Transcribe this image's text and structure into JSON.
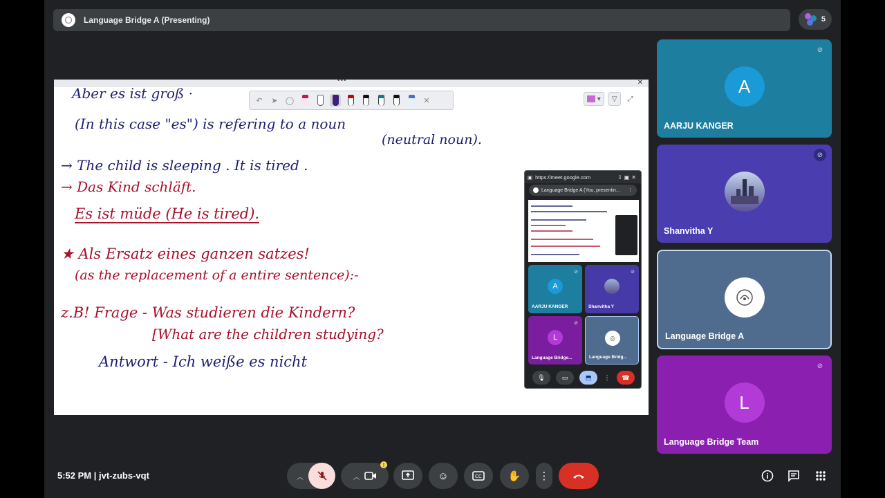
{
  "meeting": {
    "title": "Language Bridge A (Presenting)",
    "participant_count": "5",
    "time_code": "5:52 PM  |  jvt-zubs-vqt"
  },
  "slide": {
    "lines": [
      {
        "text": "Aber es ist groß ·"
      },
      {
        "text": "(In this case \"es\")  is  refering  to a noun"
      },
      {
        "text": "(neutral noun)."
      },
      {
        "text": "→ The child is sleeping . It is tired ."
      },
      {
        "text": "→ Das Kind schläft."
      },
      {
        "text": "Es ist müde (He is tired)."
      },
      {
        "text": "★ Als Ersatz eines ganzen satzes!"
      },
      {
        "text": "(as the replacement of a entire sentence):-"
      },
      {
        "text": "z.B! Frage - Was studieren die Kindern?"
      },
      {
        "text": "[What are the children studying?"
      },
      {
        "text": "Antwort - Ich weiße es nicht"
      }
    ]
  },
  "mini_window": {
    "url": "https://meet.google.com",
    "tab_title": "Language Bridge A (You, presentin...",
    "tiles": [
      {
        "initial": "A",
        "name": "AARJU KANGER"
      },
      {
        "initial": "",
        "name": "Shanvitha Y"
      },
      {
        "initial": "L",
        "name": "Language Bridge..."
      },
      {
        "initial": "",
        "name": "Language Bridg..."
      }
    ]
  },
  "participants": [
    {
      "initial": "A",
      "name": "AARJU KANGER",
      "color": "#1e8fb5"
    },
    {
      "initial": "",
      "name": "Shanvitha Y",
      "color": "#4a3db0"
    },
    {
      "initial": "",
      "name": "Language Bridge A",
      "color": "#4f6c8f"
    },
    {
      "initial": "L",
      "name": "Language Bridge Team",
      "color": "#8a1fb0"
    }
  ],
  "colors": {
    "end_call": "#d93025",
    "mic_off_bg": "#f9dedc",
    "ink_blue": "#1d1f6e",
    "ink_red": "#a8102b"
  },
  "icons": [
    "mic-off-icon",
    "camera-icon",
    "present-icon",
    "emoji-icon",
    "captions-icon",
    "raise-hand-icon",
    "more-icon",
    "end-call-icon",
    "info-icon",
    "chat-icon",
    "activities-icon"
  ]
}
